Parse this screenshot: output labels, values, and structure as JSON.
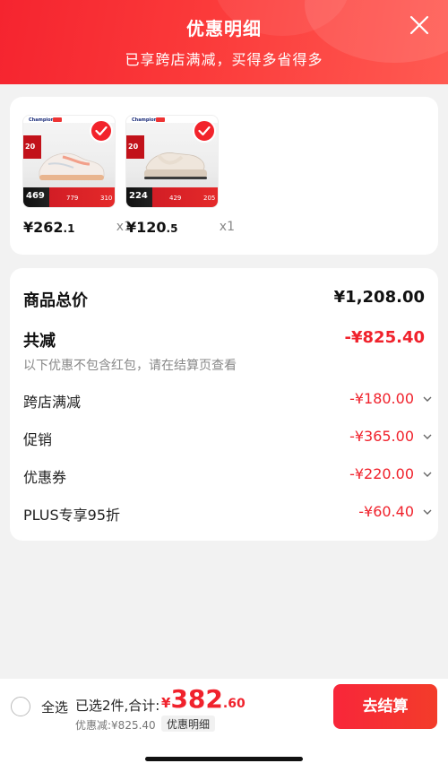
{
  "header": {
    "title": "优惠明细",
    "subtitle": "已享跨店满减，买得多省得多",
    "close_icon": "close-icon"
  },
  "products": [
    {
      "price_int": "¥262",
      "price_dec": ".1",
      "qty": "x1",
      "thumb_brand": "Champion",
      "thumb_tag": "20",
      "thumb_price": "469",
      "thumb_m1": "779",
      "thumb_m2": "310",
      "selected": true,
      "shoe_colors": {
        "upper": "#f4ede8",
        "sole": "#e9b58f",
        "accent": "#f2a08a"
      }
    },
    {
      "price_int": "¥120",
      "price_dec": ".5",
      "qty": "x1",
      "thumb_brand": "Champion",
      "thumb_tag": "20",
      "thumb_price": "224",
      "thumb_m1": "429",
      "thumb_m2": "205",
      "selected": true,
      "shoe_colors": {
        "upper": "#efe6dc",
        "sole": "#d9cbbb",
        "accent": "#e8ddd0"
      }
    }
  ],
  "summary": {
    "total_label": "商品总价",
    "total_value": "¥1,208.00",
    "reduce_label": "共减",
    "reduce_value": "-¥825.40",
    "note": "以下优惠不包含红包，请在结算页查看",
    "items": [
      {
        "label": "跨店满减",
        "value": "-¥180.00"
      },
      {
        "label": "促销",
        "value": "-¥365.00"
      },
      {
        "label": "优惠券",
        "value": "-¥220.00"
      },
      {
        "label": "PLUS专享95折",
        "value": "-¥60.40"
      }
    ]
  },
  "bottom": {
    "select_all": "全选",
    "selected_text": "已选2件,合计:",
    "total_currency": "¥",
    "total_int": "382",
    "total_dec": ".60",
    "discount_text": "优惠减:¥825.40",
    "detail_chip": "优惠明细",
    "checkout": "去结算"
  },
  "colors": {
    "accent_red": "#f0222c",
    "header_red": "#f5242f"
  }
}
